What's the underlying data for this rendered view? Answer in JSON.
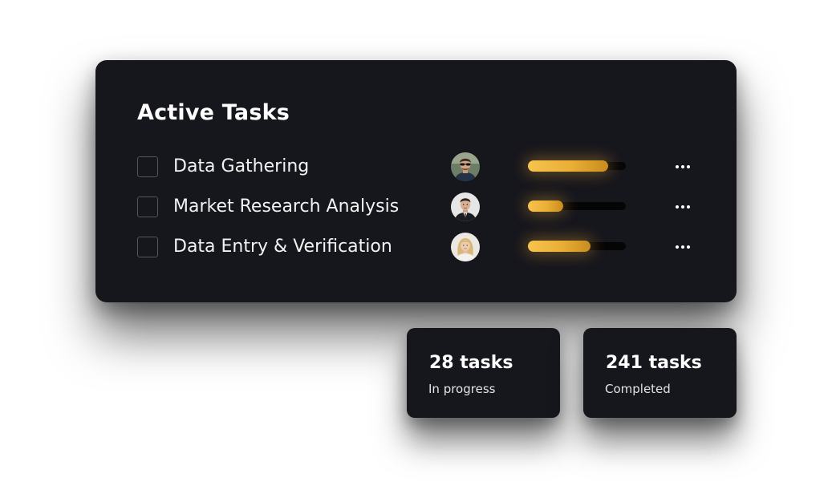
{
  "title": "Active Tasks",
  "tasks": [
    {
      "name": "Data Gathering",
      "progress": 0.82,
      "avatar": "avatar-man-sunglasses"
    },
    {
      "name": "Market Research Analysis",
      "progress": 0.36,
      "avatar": "avatar-man-suit"
    },
    {
      "name": "Data Entry & Verification",
      "progress": 0.64,
      "avatar": "avatar-woman-blonde"
    }
  ],
  "stats": {
    "in_progress": {
      "value": "28 tasks",
      "label": "In progress"
    },
    "completed": {
      "value": "241 tasks",
      "label": "Completed"
    }
  },
  "colors": {
    "card_background": "#16161d",
    "progress_accent": "#f0b53f",
    "progress_track": "#050506",
    "text": "#ffffff"
  },
  "icons": {
    "checkbox": "checkbox-unchecked-icon",
    "more": "more-horizontal-icon"
  }
}
